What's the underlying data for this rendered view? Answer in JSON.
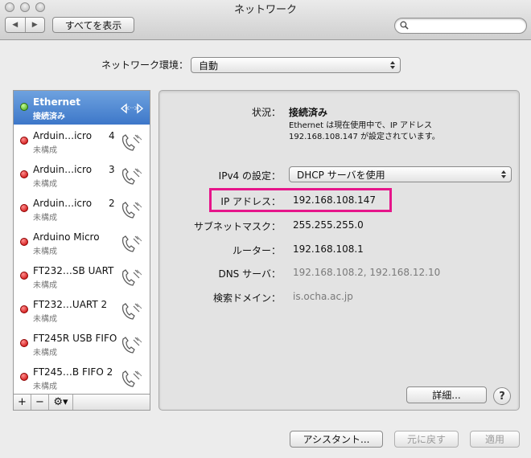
{
  "window": {
    "title": "ネットワーク"
  },
  "toolbar": {
    "back_glyph": "◀",
    "forward_glyph": "▶",
    "show_all_label": "すべてを表示",
    "search_value": "",
    "search_placeholder": ""
  },
  "location": {
    "label": "ネットワーク環境：",
    "value": "自動"
  },
  "services": [
    {
      "name": "Ethernet",
      "status": "接続済み",
      "number": "",
      "state": "connected",
      "icon": "ethernet-icon"
    },
    {
      "name": "Arduin…icro",
      "status": "未構成",
      "number": "4",
      "state": "not-configured",
      "icon": "modem-phone-icon"
    },
    {
      "name": "Arduin…icro",
      "status": "未構成",
      "number": "3",
      "state": "not-configured",
      "icon": "modem-phone-icon"
    },
    {
      "name": "Arduin…icro",
      "status": "未構成",
      "number": "2",
      "state": "not-configured",
      "icon": "modem-phone-icon"
    },
    {
      "name": "Arduino Micro",
      "status": "未構成",
      "number": "",
      "state": "not-configured",
      "icon": "modem-phone-icon"
    },
    {
      "name": "FT232…SB UART",
      "status": "未構成",
      "number": "",
      "state": "not-configured",
      "icon": "modem-phone-icon"
    },
    {
      "name": "FT232…UART 2",
      "status": "未構成",
      "number": "",
      "state": "not-configured",
      "icon": "modem-phone-icon"
    },
    {
      "name": "FT245R USB FIFO",
      "status": "未構成",
      "number": "",
      "state": "not-configured",
      "icon": "modem-phone-icon"
    },
    {
      "name": "FT245…B FIFO 2",
      "status": "未構成",
      "number": "",
      "state": "not-configured",
      "icon": "modem-phone-icon"
    }
  ],
  "sidebar_tools": {
    "add": "+",
    "remove": "−",
    "gear": "⚙▾"
  },
  "detail": {
    "status_label": "状況：",
    "status_value": "接続済み",
    "description_line1": "Ethernet は現在使用中で、IP アドレス",
    "description_line2": "192.168.108.147 が設定されています。",
    "ipv4_label": "IPv4 の設定：",
    "ipv4_value": "DHCP サーバを使用",
    "ip_label": "IP アドレス：",
    "ip_value": "192.168.108.147",
    "subnet_label": "サブネットマスク：",
    "subnet_value": "255.255.255.0",
    "router_label": "ルーター：",
    "router_value": "192.168.108.1",
    "dns_label": "DNS サーバ：",
    "dns_value": "192.168.108.2, 192.168.12.10",
    "domain_label": "検索ドメイン：",
    "domain_value": "is.ocha.ac.jp",
    "advanced_label": "詳細...",
    "help_label": "?"
  },
  "footer": {
    "assistant_label": "アシスタント...",
    "revert_label": "元に戻す",
    "apply_label": "適用"
  },
  "colors": {
    "highlight": "#e6158a",
    "selection": "#3d77c9",
    "status_red": "#c80000",
    "status_green": "#3fa012"
  }
}
